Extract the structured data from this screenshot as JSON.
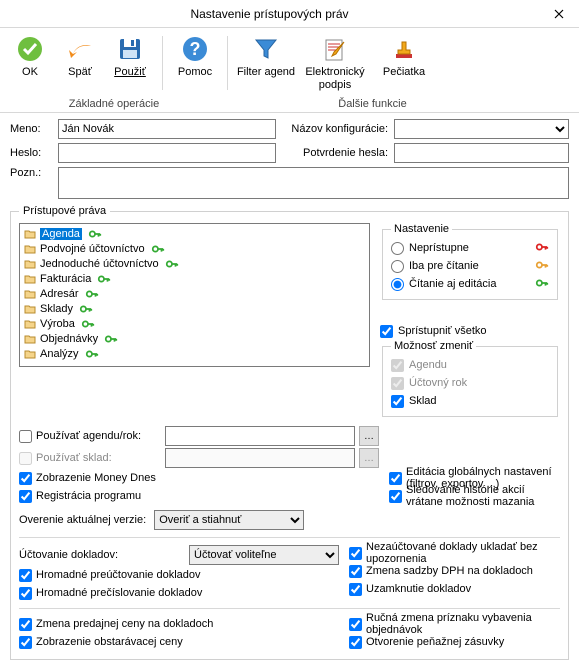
{
  "window": {
    "title": "Nastavenie prístupových práv"
  },
  "ribbon": {
    "ok": "OK",
    "back": "Späť",
    "use": "Použiť",
    "help": "Pomoc",
    "filter": "Filter agend",
    "epodpis_l1": "Elektronický",
    "epodpis_l2": "podpis",
    "stamp": "Pečiatka",
    "grp1": "Základné operácie",
    "grp2": "Ďalšie funkcie"
  },
  "form": {
    "name_label": "Meno:",
    "name_value": "Ján Novák",
    "cfg_label": "Názov konfigurácie:",
    "cfg_value": "",
    "pwd_label": "Heslo:",
    "pwd_value": "",
    "pwd2_label": "Potvrdenie hesla:",
    "pwd2_value": "",
    "note_label": "Pozn.:",
    "note_value": ""
  },
  "rights": {
    "legend": "Prístupové práva",
    "items": [
      "Agenda",
      "Podvojné účtovníctvo",
      "Jednoduché účtovníctvo",
      "Fakturácia",
      "Adresár",
      "Sklady",
      "Výroba",
      "Objednávky",
      "Analýzy"
    ]
  },
  "settings": {
    "legend": "Nastavenie",
    "none": "Neprístupne",
    "read": "Iba pre čítanie",
    "readwrite": "Čítanie aj editácia",
    "share_all": "Sprístupniť všetko",
    "change_legend": "Možnosť zmeniť",
    "agenda": "Agendu",
    "year": "Účtovný rok",
    "sklad": "Sklad"
  },
  "opts_left": {
    "use_agenda": "Používať agendu/rok:",
    "use_sklad": "Používať sklad:",
    "money_dnes": "Zobrazenie Money Dnes",
    "reg": "Registrácia programu",
    "verify_label": "Overenie aktuálnej verzie:",
    "verify_value": "Overiť a stiahnuť"
  },
  "opts_right": {
    "edit_global": "Editácia globálnych nastavení (filtrov, exportov  ...)",
    "history": "Sledovanie histórie akcií vrátane možnosti mazania"
  },
  "acct": {
    "label": "Účtovanie dokladov:",
    "value": "Účtovať voliteľne",
    "bulk_reacct": "Hromadné preúčtovanie dokladov",
    "bulk_renum": "Hromadné prečíslovanie dokladov"
  },
  "acct_right": {
    "unposted": "Nezaúčtované doklady ukladať bez upozornenia",
    "vat": "Zmena sadzby DPH na dokladoch",
    "lock": "Uzamknutie dokladov"
  },
  "bottom_left": {
    "sell_price": "Zmena predajnej ceny na dokladoch",
    "acq_price": "Zobrazenie obstarávacej ceny"
  },
  "bottom_right": {
    "manual_flag": "Ručná zmena príznaku vybavenia objednávok",
    "cash_drawer": "Otvorenie peňažnej zásuvky"
  }
}
